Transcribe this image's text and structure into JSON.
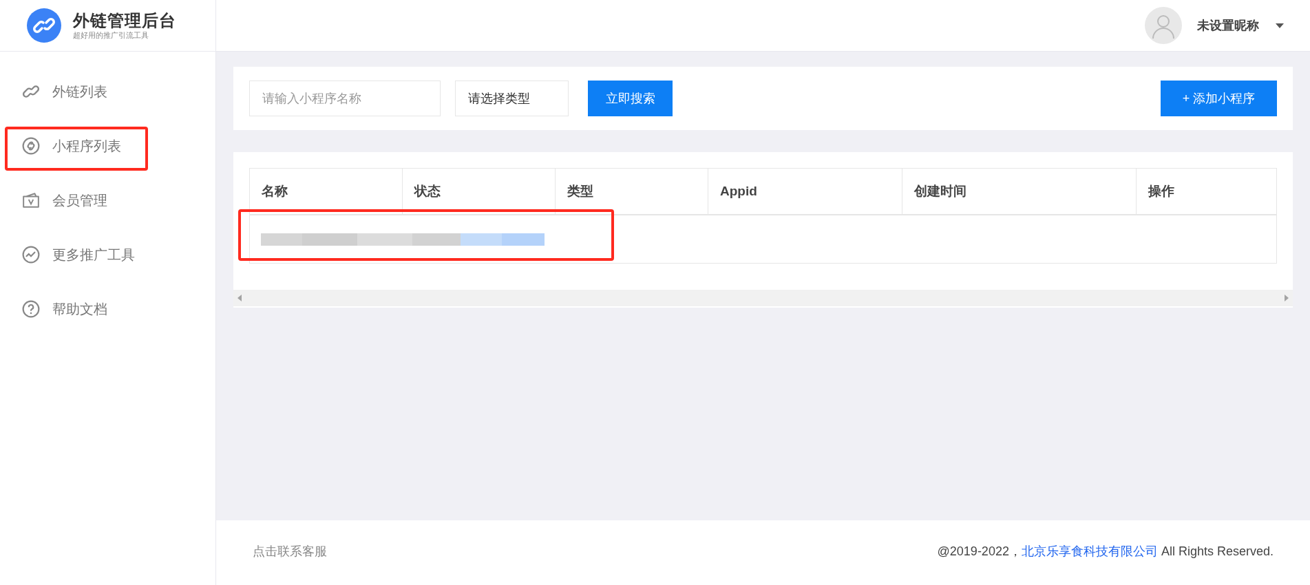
{
  "brand": {
    "title": "外链管理后台",
    "subtitle": "超好用的推广引流工具"
  },
  "user": {
    "name": "未设置昵称"
  },
  "sidebar": {
    "items": [
      {
        "label": "外链列表"
      },
      {
        "label": "小程序列表"
      },
      {
        "label": "会员管理"
      },
      {
        "label": "更多推广工具"
      },
      {
        "label": "帮助文档"
      }
    ]
  },
  "search": {
    "name_placeholder": "请输入小程序名称",
    "type_select": "请选择类型",
    "search_button": "立即搜索",
    "add_button": "+ 添加小程序"
  },
  "table": {
    "columns": [
      "名称",
      "状态",
      "类型",
      "Appid",
      "创建时间",
      "操作"
    ]
  },
  "footer": {
    "contact": "点击联系客服",
    "copyright_prefix": "@2019-2022，",
    "company": "北京乐享食科技有限公司",
    "copyright_suffix": " All Rights Reserved."
  }
}
